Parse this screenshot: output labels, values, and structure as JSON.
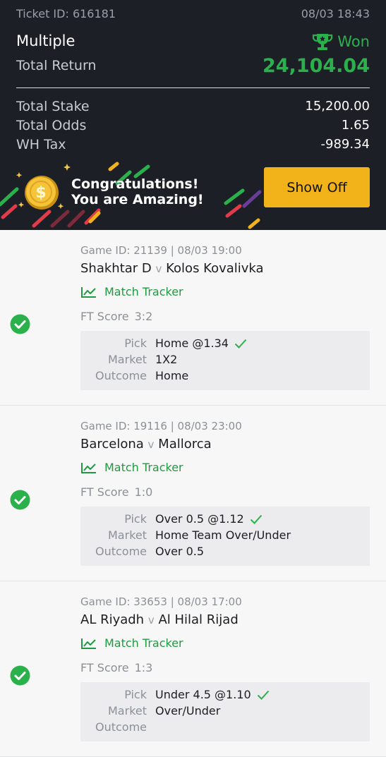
{
  "ticket": {
    "id_text": "Ticket ID: 616181",
    "datetime": "08/03 18:43",
    "bet_type": "Multiple",
    "status": "Won",
    "total_return_label": "Total Return",
    "total_return_value": "24,104.04",
    "summary": [
      {
        "label": "Total Stake",
        "value": "15,200.00"
      },
      {
        "label": "Total Odds",
        "value": "1.65"
      },
      {
        "label": "WH Tax",
        "value": "-989.34"
      }
    ]
  },
  "banner": {
    "line1": "Congratulations!",
    "line2": "You are Amazing!",
    "button": "Show Off"
  },
  "games": [
    {
      "game_id": "Game ID: 21139 | 08/03 19:00",
      "home": "Shakhtar D",
      "vs": "v",
      "away": "Kolos Kovalivka",
      "tracker": "Match Tracker",
      "score_label": "FT Score",
      "score": "3:2",
      "pick_label": "Pick",
      "pick": "Home @1.34",
      "market_label": "Market",
      "market": "1X2",
      "outcome_label": "Outcome",
      "outcome": "Home"
    },
    {
      "game_id": "Game ID: 19116 | 08/03 23:00",
      "home": "Barcelona",
      "vs": "v",
      "away": "Mallorca",
      "tracker": "Match Tracker",
      "score_label": "FT Score",
      "score": "1:0",
      "pick_label": "Pick",
      "pick": "Over 0.5 @1.12",
      "market_label": "Market",
      "market": "Home Team Over/Under",
      "outcome_label": "Outcome",
      "outcome": "Over 0.5"
    },
    {
      "game_id": "Game ID: 33653 | 08/03 17:00",
      "home": "AL Riyadh",
      "vs": "v",
      "away": "Al Hilal Rijad",
      "tracker": "Match Tracker",
      "score_label": "FT Score",
      "score": "1:3",
      "pick_label": "Pick",
      "pick": "Under 4.5 @1.10",
      "market_label": "Market",
      "market": "Over/Under",
      "outcome_label": "Outcome",
      "outcome": ""
    }
  ],
  "colors": {
    "header_bg": "#1c1f26",
    "win_green": "#2bb14b",
    "button_yellow": "#f2b21a"
  },
  "icons": [
    "trophy-icon",
    "coin-icon",
    "chart-line-icon",
    "check-circle-icon",
    "check-icon"
  ]
}
